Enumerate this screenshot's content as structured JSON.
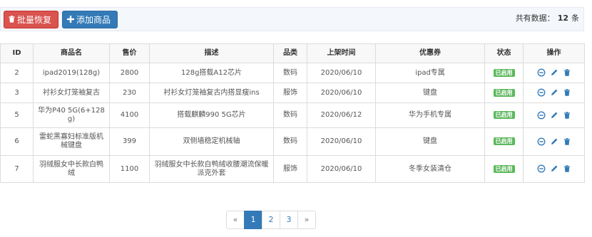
{
  "toolbar": {
    "batch_restore_label": "批量恢复",
    "add_product_label": "添加商品",
    "total_prefix": "共有数据：",
    "total_count": "12",
    "total_suffix": "条"
  },
  "table": {
    "headers": [
      "ID",
      "商品名",
      "售价",
      "描述",
      "品类",
      "上架时间",
      "优惠券",
      "状态",
      "操作"
    ],
    "rows": [
      {
        "id": "2",
        "name": "ipad2019(128g)",
        "price": "2800",
        "desc": "128g搭载A12芯片",
        "category": "数码",
        "date": "2020/06/10",
        "coupon": "ipad专属",
        "status": "已启用"
      },
      {
        "id": "3",
        "name": "衬衫女灯笼袖复古",
        "price": "230",
        "desc": "衬衫女灯笼袖复古内搭显瘦ins",
        "category": "服饰",
        "date": "2020/06/10",
        "coupon": "键盘",
        "status": "已启用"
      },
      {
        "id": "5",
        "name": "华为P40 5G(6+128g)",
        "price": "4100",
        "desc": "搭载麒麟990 5G芯片",
        "category": "数码",
        "date": "2020/06/12",
        "coupon": "华为手机专属",
        "status": "已启用"
      },
      {
        "id": "6",
        "name": "雷蛇黑寡妇标准版机械键盘",
        "price": "399",
        "desc": "双侧墙稳定机械轴",
        "category": "数码",
        "date": "2020/06/10",
        "coupon": "键盘",
        "status": "已启用"
      },
      {
        "id": "7",
        "name": "羽绒服女中长款白鸭绒",
        "price": "1100",
        "desc": "羽绒服女中长款白鸭绒收腰潮流保暖派克外套",
        "category": "服饰",
        "date": "2020/06/10",
        "coupon": "冬季女装清仓",
        "status": "已启用"
      }
    ]
  },
  "icons": {
    "batch_restore": "trash-icon",
    "add_product": "plus-icon",
    "row_ops": [
      "disable-icon",
      "edit-pencil-icon",
      "delete-trash-icon"
    ]
  },
  "pagination": {
    "prev": "«",
    "pages": [
      "1",
      "2",
      "3"
    ],
    "current": "1",
    "next": "»"
  },
  "colors": {
    "danger": "#d9534f",
    "primary": "#337ab7",
    "success": "#5cb85c"
  }
}
